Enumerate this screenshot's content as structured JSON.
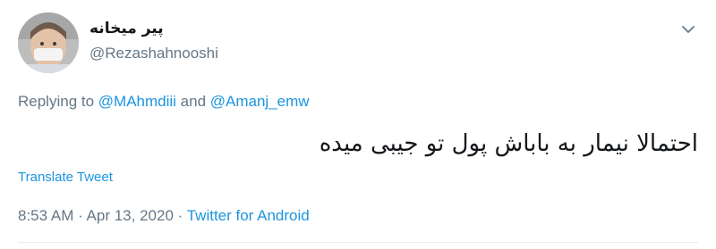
{
  "tweet": {
    "author": {
      "display_name": "پیر میخانه",
      "handle": "@Rezashahnooshi"
    },
    "replying": {
      "prefix": "Replying to ",
      "mention1": "@MAhmdiii",
      "conjunction": " and ",
      "mention2": "@Amanj_emw"
    },
    "text": "احتمالا نیمار به باباش پول تو جیبی میده",
    "translate_label": "Translate Tweet",
    "meta": {
      "time": "8:53 AM",
      "separator1": " · ",
      "date": "Apr 13, 2020",
      "separator2": " · ",
      "source": "Twitter for Android"
    },
    "icons": {
      "menu": "chevron-down-icon",
      "avatar": "avatar"
    }
  }
}
